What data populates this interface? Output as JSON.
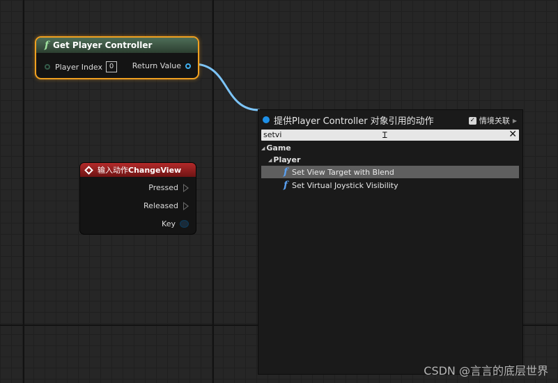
{
  "get_player_controller": {
    "title": "Get Player Controller",
    "input_label": "Player Index",
    "input_value": "0",
    "output_label": "Return Value"
  },
  "input_action_node": {
    "title_prefix": "输入动作",
    "title_action": "ChangeView",
    "pins": [
      "Pressed",
      "Released",
      "Key"
    ]
  },
  "action_menu": {
    "title": "提供Player Controller 对象引用的动作",
    "context_label": "情境关联",
    "context_checked": true,
    "search_value": "setvi",
    "categories": [
      "Game",
      "Player"
    ],
    "items": [
      "Set View Target with Blend",
      "Set Virtual Joystick Visibility"
    ],
    "selected_item": "Set View Target with Blend"
  },
  "watermark": "CSDN @言言的底层世界",
  "colors": {
    "node_highlight": "#f0a020",
    "input_header": "#b32a2a",
    "wire": "#7cc4f8",
    "selection": "#5f5f5f"
  }
}
